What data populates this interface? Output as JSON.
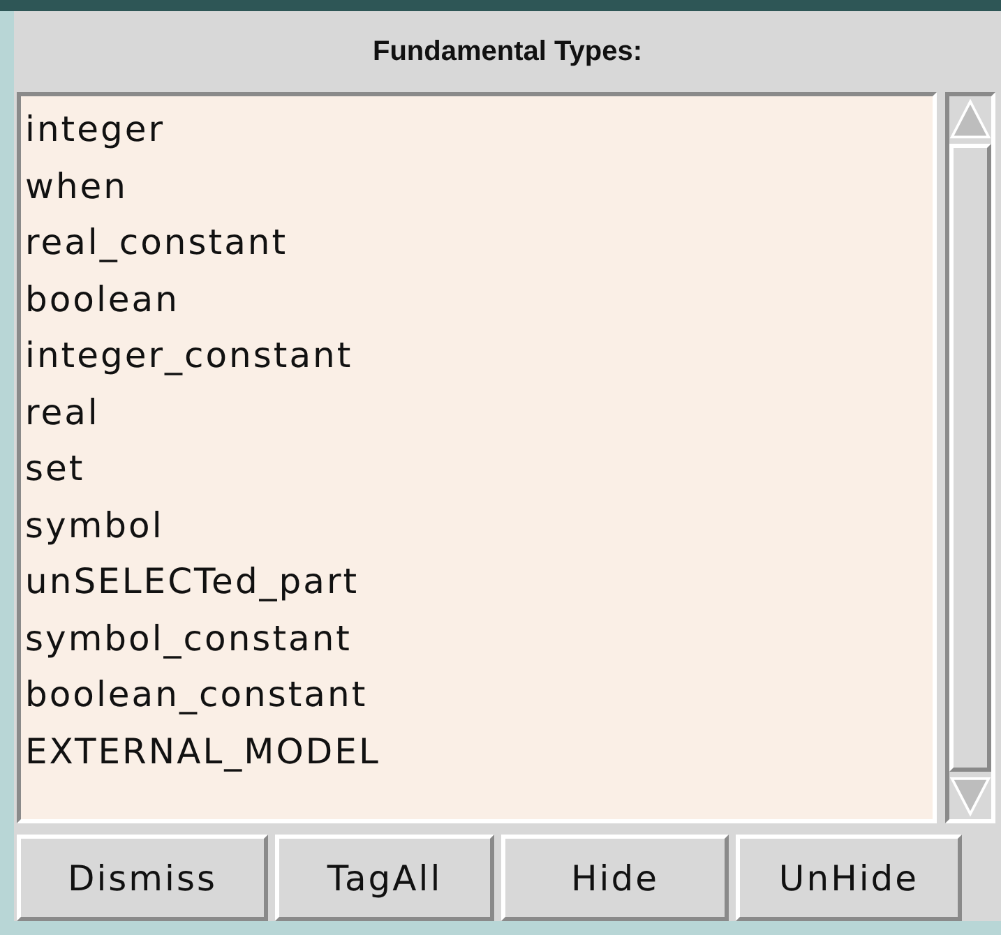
{
  "title": "Fundamental Types:",
  "items": [
    "integer",
    "when",
    "real_constant",
    "boolean",
    "integer_constant",
    "real",
    "set",
    "symbol",
    "unSELECTed_part",
    "symbol_constant",
    "boolean_constant",
    "EXTERNAL_MODEL"
  ],
  "buttons": [
    "Dismiss",
    "TagAll",
    "Hide",
    "UnHide"
  ]
}
